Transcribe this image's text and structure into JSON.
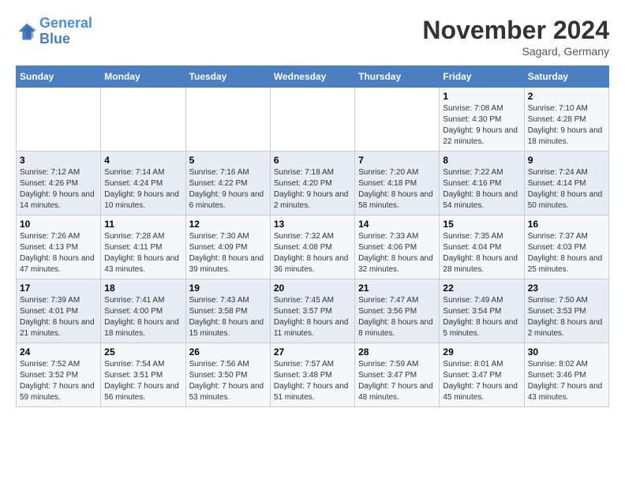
{
  "logo": {
    "line1": "General",
    "line2": "Blue"
  },
  "title": "November 2024",
  "location": "Sagard, Germany",
  "days_of_week": [
    "Sunday",
    "Monday",
    "Tuesday",
    "Wednesday",
    "Thursday",
    "Friday",
    "Saturday"
  ],
  "weeks": [
    [
      {
        "day": "",
        "info": ""
      },
      {
        "day": "",
        "info": ""
      },
      {
        "day": "",
        "info": ""
      },
      {
        "day": "",
        "info": ""
      },
      {
        "day": "",
        "info": ""
      },
      {
        "day": "1",
        "info": "Sunrise: 7:08 AM\nSunset: 4:30 PM\nDaylight: 9 hours and 22 minutes."
      },
      {
        "day": "2",
        "info": "Sunrise: 7:10 AM\nSunset: 4:28 PM\nDaylight: 9 hours and 18 minutes."
      }
    ],
    [
      {
        "day": "3",
        "info": "Sunrise: 7:12 AM\nSunset: 4:26 PM\nDaylight: 9 hours and 14 minutes."
      },
      {
        "day": "4",
        "info": "Sunrise: 7:14 AM\nSunset: 4:24 PM\nDaylight: 9 hours and 10 minutes."
      },
      {
        "day": "5",
        "info": "Sunrise: 7:16 AM\nSunset: 4:22 PM\nDaylight: 9 hours and 6 minutes."
      },
      {
        "day": "6",
        "info": "Sunrise: 7:18 AM\nSunset: 4:20 PM\nDaylight: 9 hours and 2 minutes."
      },
      {
        "day": "7",
        "info": "Sunrise: 7:20 AM\nSunset: 4:18 PM\nDaylight: 8 hours and 58 minutes."
      },
      {
        "day": "8",
        "info": "Sunrise: 7:22 AM\nSunset: 4:16 PM\nDaylight: 8 hours and 54 minutes."
      },
      {
        "day": "9",
        "info": "Sunrise: 7:24 AM\nSunset: 4:14 PM\nDaylight: 8 hours and 50 minutes."
      }
    ],
    [
      {
        "day": "10",
        "info": "Sunrise: 7:26 AM\nSunset: 4:13 PM\nDaylight: 8 hours and 47 minutes."
      },
      {
        "day": "11",
        "info": "Sunrise: 7:28 AM\nSunset: 4:11 PM\nDaylight: 8 hours and 43 minutes."
      },
      {
        "day": "12",
        "info": "Sunrise: 7:30 AM\nSunset: 4:09 PM\nDaylight: 8 hours and 39 minutes."
      },
      {
        "day": "13",
        "info": "Sunrise: 7:32 AM\nSunset: 4:08 PM\nDaylight: 8 hours and 36 minutes."
      },
      {
        "day": "14",
        "info": "Sunrise: 7:33 AM\nSunset: 4:06 PM\nDaylight: 8 hours and 32 minutes."
      },
      {
        "day": "15",
        "info": "Sunrise: 7:35 AM\nSunset: 4:04 PM\nDaylight: 8 hours and 28 minutes."
      },
      {
        "day": "16",
        "info": "Sunrise: 7:37 AM\nSunset: 4:03 PM\nDaylight: 8 hours and 25 minutes."
      }
    ],
    [
      {
        "day": "17",
        "info": "Sunrise: 7:39 AM\nSunset: 4:01 PM\nDaylight: 8 hours and 21 minutes."
      },
      {
        "day": "18",
        "info": "Sunrise: 7:41 AM\nSunset: 4:00 PM\nDaylight: 8 hours and 18 minutes."
      },
      {
        "day": "19",
        "info": "Sunrise: 7:43 AM\nSunset: 3:58 PM\nDaylight: 8 hours and 15 minutes."
      },
      {
        "day": "20",
        "info": "Sunrise: 7:45 AM\nSunset: 3:57 PM\nDaylight: 8 hours and 11 minutes."
      },
      {
        "day": "21",
        "info": "Sunrise: 7:47 AM\nSunset: 3:56 PM\nDaylight: 8 hours and 8 minutes."
      },
      {
        "day": "22",
        "info": "Sunrise: 7:49 AM\nSunset: 3:54 PM\nDaylight: 8 hours and 5 minutes."
      },
      {
        "day": "23",
        "info": "Sunrise: 7:50 AM\nSunset: 3:53 PM\nDaylight: 8 hours and 2 minutes."
      }
    ],
    [
      {
        "day": "24",
        "info": "Sunrise: 7:52 AM\nSunset: 3:52 PM\nDaylight: 7 hours and 59 minutes."
      },
      {
        "day": "25",
        "info": "Sunrise: 7:54 AM\nSunset: 3:51 PM\nDaylight: 7 hours and 56 minutes."
      },
      {
        "day": "26",
        "info": "Sunrise: 7:56 AM\nSunset: 3:50 PM\nDaylight: 7 hours and 53 minutes."
      },
      {
        "day": "27",
        "info": "Sunrise: 7:57 AM\nSunset: 3:48 PM\nDaylight: 7 hours and 51 minutes."
      },
      {
        "day": "28",
        "info": "Sunrise: 7:59 AM\nSunset: 3:47 PM\nDaylight: 7 hours and 48 minutes."
      },
      {
        "day": "29",
        "info": "Sunrise: 8:01 AM\nSunset: 3:47 PM\nDaylight: 7 hours and 45 minutes."
      },
      {
        "day": "30",
        "info": "Sunrise: 8:02 AM\nSunset: 3:46 PM\nDaylight: 7 hours and 43 minutes."
      }
    ]
  ]
}
